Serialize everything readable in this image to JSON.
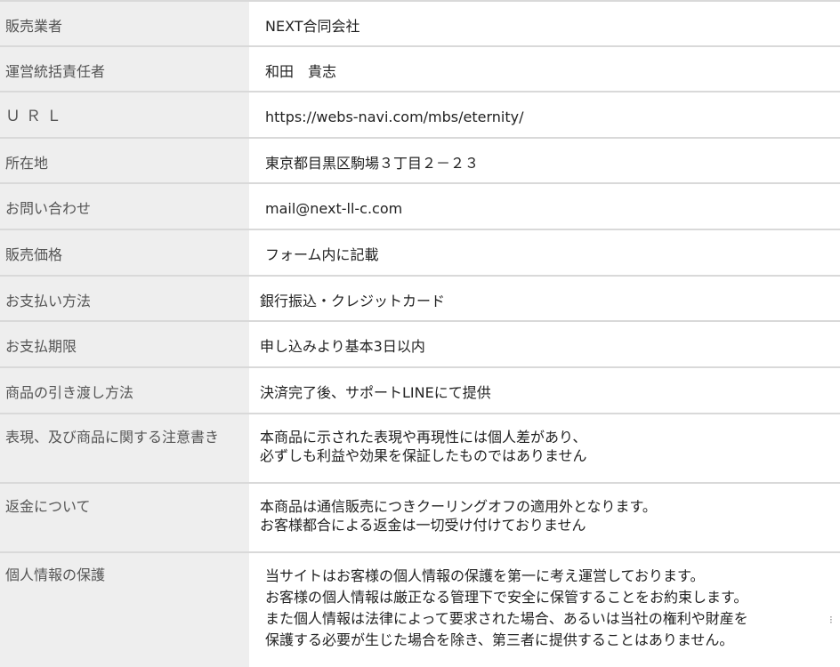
{
  "rows": [
    {
      "label": "販売業者",
      "value": [
        "NEXT合同会社"
      ]
    },
    {
      "label": "運営統括責任者",
      "value": [
        "和田　貴志"
      ]
    },
    {
      "label": "ＵＲＬ",
      "value": [
        "https://webs-navi.com/mbs/eternity/"
      ]
    },
    {
      "label": "所在地",
      "value": [
        "東京都目黒区駒場３丁目２－２３"
      ]
    },
    {
      "label": "お問い合わせ",
      "value": [
        "mail@next-ll-c.com"
      ]
    },
    {
      "label": "販売価格",
      "value": [
        "フォーム内に記載"
      ]
    },
    {
      "label": "お支払い方法",
      "value": [
        "銀行振込・クレジットカード"
      ]
    },
    {
      "label": "お支払期限",
      "value": [
        "申し込みより基本3日以内"
      ]
    },
    {
      "label": "商品の引き渡し方法",
      "value": [
        "決済完了後、サポートLINEにて提供"
      ]
    },
    {
      "label": "表現、及び商品に関する注意書き",
      "value": [
        "本商品に示された表現や再現性には個人差があり、",
        "必ずしも利益や効果を保証したものではありません"
      ]
    },
    {
      "label": "返金について",
      "value": [
        "本商品は通信販売につきクーリングオフの適用外となります。",
        "お客様都合による返金は一切受け付けておりません"
      ]
    },
    {
      "label": "個人情報の保護",
      "value": [
        "当サイトはお客様の個人情報の保護を第一に考え運営しております。",
        "お客様の個人情報は厳正なる管理下で安全に保管することをお約束します。",
        "また個人情報は法律によって要求された場合、あるいは当社の権利や財産を",
        "保護する必要が生じた場合を除き、第三者に提供することはありません。"
      ]
    }
  ],
  "scroll_marker": "⁝"
}
